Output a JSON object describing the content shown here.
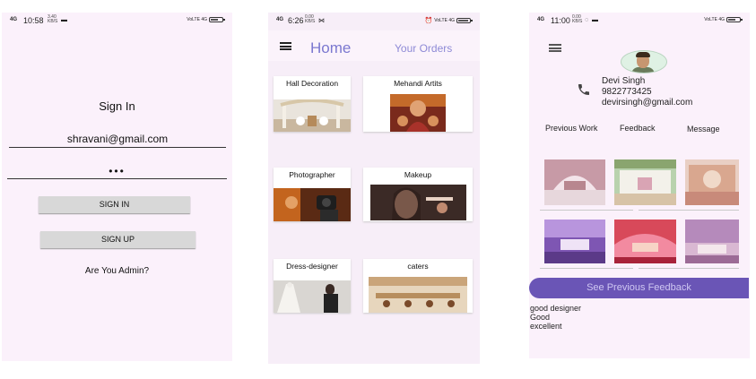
{
  "colors": {
    "accent": "#7b78d0",
    "feedback_button": "#6a55b6",
    "screen_bg": "#fbf1fb"
  },
  "phone1": {
    "status": {
      "signal": "4G",
      "time": "10:58",
      "net": "3.40 KB/S",
      "right": "VoLTE 4G"
    },
    "title": "Sign In",
    "email": "shravani@gmail.com",
    "password_mask": "•••",
    "signin_label": "SIGN IN",
    "signup_label": "SIGN UP",
    "admin_text": "Are You Admin?"
  },
  "phone2": {
    "status": {
      "signal": "4G",
      "time": "6:26",
      "net": "0.00 KB/S",
      "right": "VoLTE 4G"
    },
    "tabs": {
      "home": "Home",
      "orders": "Your Orders"
    },
    "cards": [
      {
        "label": "Hall Decoration"
      },
      {
        "label": "Mehandi Artits"
      },
      {
        "label": "Photographer"
      },
      {
        "label": "Makeup"
      },
      {
        "label": "Dress-designer"
      },
      {
        "label": "caters"
      }
    ]
  },
  "phone3": {
    "status": {
      "signal": "4G",
      "time": "11:00",
      "net": "0.00 KB/S",
      "right": "VoLTE 4G"
    },
    "profile": {
      "name": "Devi Singh",
      "phone": "9822773425",
      "email": "devirsingh@gmail.com"
    },
    "tabs": {
      "work": "Previous Work",
      "feedback": "Feedback",
      "message": "Message"
    },
    "feedback_button": "See Previous Feedback",
    "feedbacks": [
      "good designer",
      "Good",
      "excellent"
    ]
  }
}
